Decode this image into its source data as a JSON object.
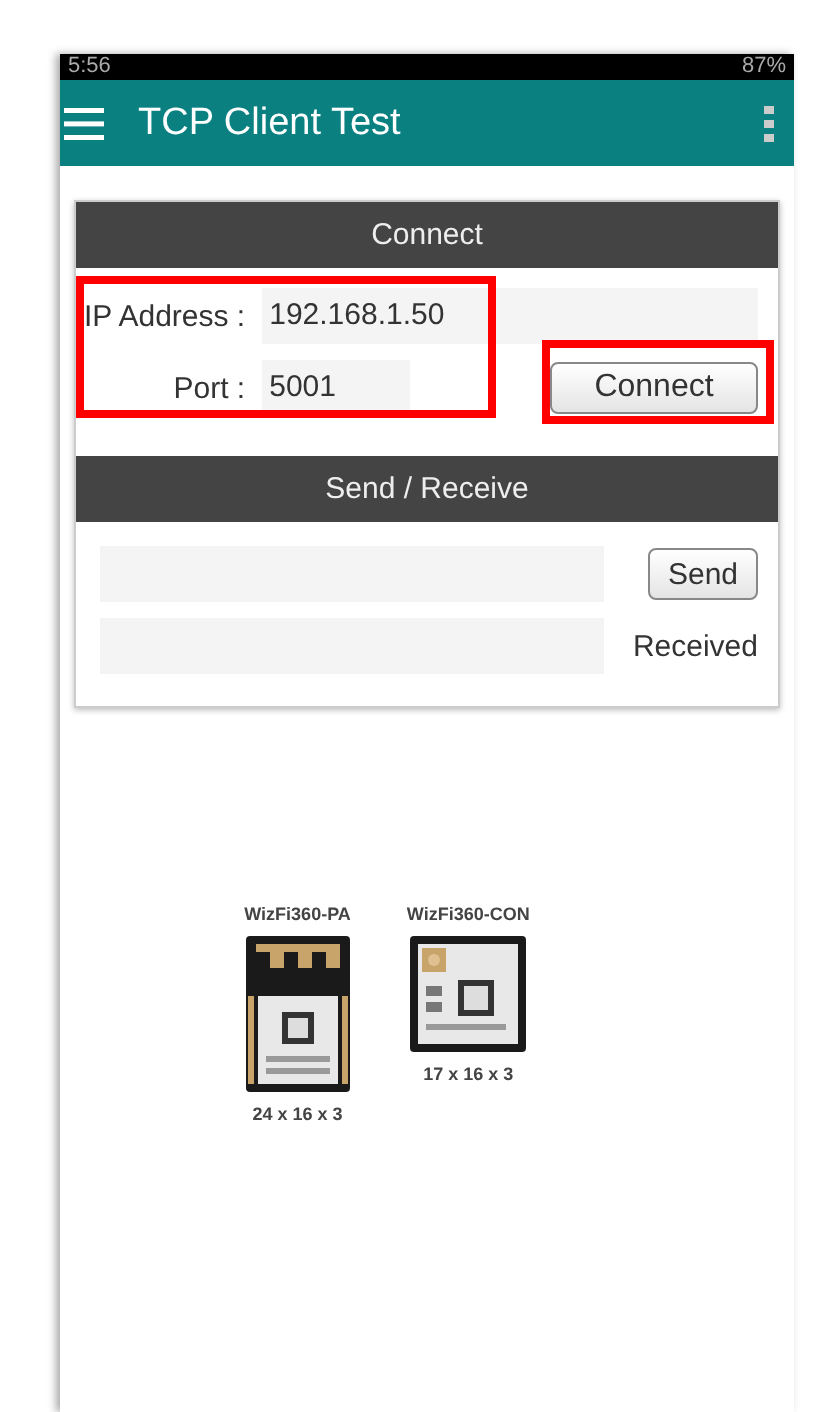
{
  "status_bar": {
    "time": "5:56",
    "battery": "87%"
  },
  "app_bar": {
    "title": "TCP Client Test"
  },
  "connect_section": {
    "header": "Connect",
    "ip_label": "IP Address :",
    "ip_value": "192.168.1.50",
    "port_label": "Port :",
    "port_value": "5001",
    "button": "Connect"
  },
  "send_section": {
    "header": "Send / Receive",
    "send_button": "Send",
    "received_label": "Received"
  },
  "modules": [
    {
      "name": "WizFi360-PA",
      "size": "24 x 16 x 3",
      "kind": "pa"
    },
    {
      "name": "WizFi360-CON",
      "size": "17 x 16 x 3",
      "kind": "con"
    }
  ]
}
